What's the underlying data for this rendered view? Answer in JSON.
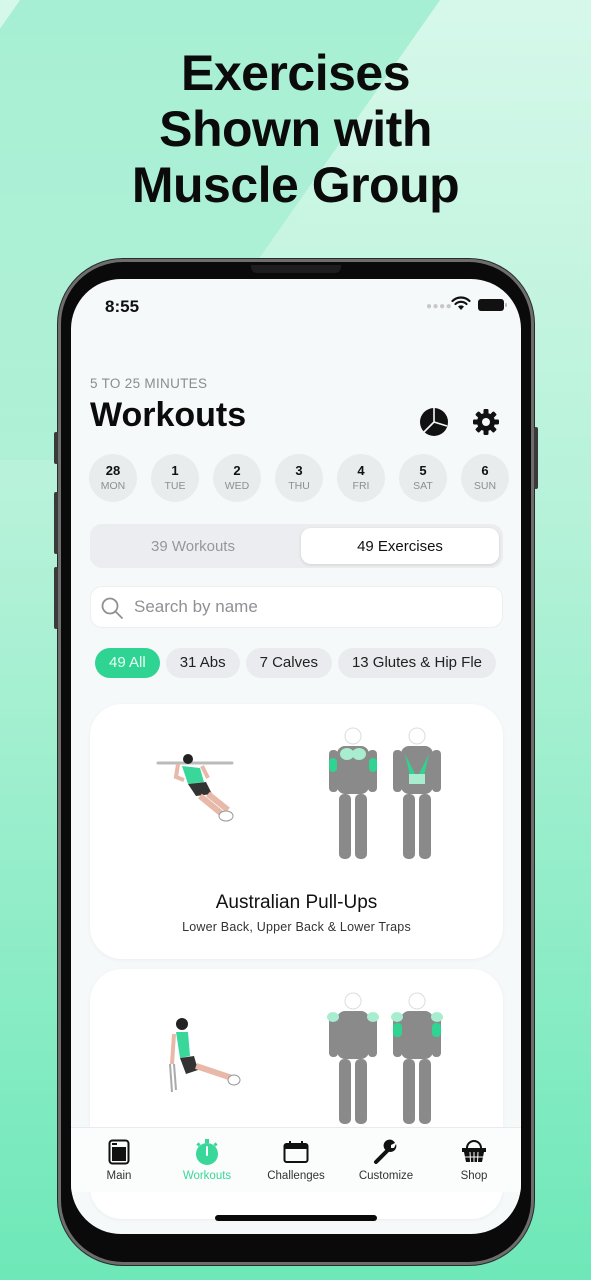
{
  "promo": {
    "headline_lines": [
      "Exercises",
      "Shown with",
      "Muscle Group"
    ]
  },
  "status_bar": {
    "time": "8:55"
  },
  "header": {
    "subtitle": "5 TO 25 MINUTES",
    "title": "Workouts",
    "stats_icon": "pie-chart-icon",
    "settings_icon": "gear-icon"
  },
  "days": [
    {
      "num": "28",
      "dow": "MON"
    },
    {
      "num": "1",
      "dow": "TUE"
    },
    {
      "num": "2",
      "dow": "WED"
    },
    {
      "num": "3",
      "dow": "THU"
    },
    {
      "num": "4",
      "dow": "FRI"
    },
    {
      "num": "5",
      "dow": "SAT"
    },
    {
      "num": "6",
      "dow": "SUN"
    }
  ],
  "segment": {
    "workouts_label": "39 Workouts",
    "exercises_label": "49 Exercises",
    "selected": "49 Exercises"
  },
  "search": {
    "placeholder": "Search by name",
    "value": ""
  },
  "filters": [
    {
      "label": "49 All",
      "active": true
    },
    {
      "label": "31 Abs",
      "active": false
    },
    {
      "label": "7 Calves",
      "active": false
    },
    {
      "label": "13 Glutes & Hip Fle",
      "active": false
    }
  ],
  "exercises": [
    {
      "name": "Australian Pull-Ups",
      "muscles": "Lower Back, Upper Back & Lower Traps"
    },
    {
      "name": "",
      "muscles": ""
    }
  ],
  "tabbar": {
    "items": [
      {
        "label": "Main",
        "icon": "main-icon"
      },
      {
        "label": "Workouts",
        "icon": "stopwatch-icon",
        "active": true
      },
      {
        "label": "Challenges",
        "icon": "calendar-icon"
      },
      {
        "label": "Customize",
        "icon": "wrench-icon"
      },
      {
        "label": "Shop",
        "icon": "basket-icon"
      }
    ]
  },
  "colors": {
    "accent": "#2fd492",
    "accent_text": "#3ad79b",
    "muscle_highlight": "#2fd492",
    "muscle_light": "#a8edd0"
  }
}
